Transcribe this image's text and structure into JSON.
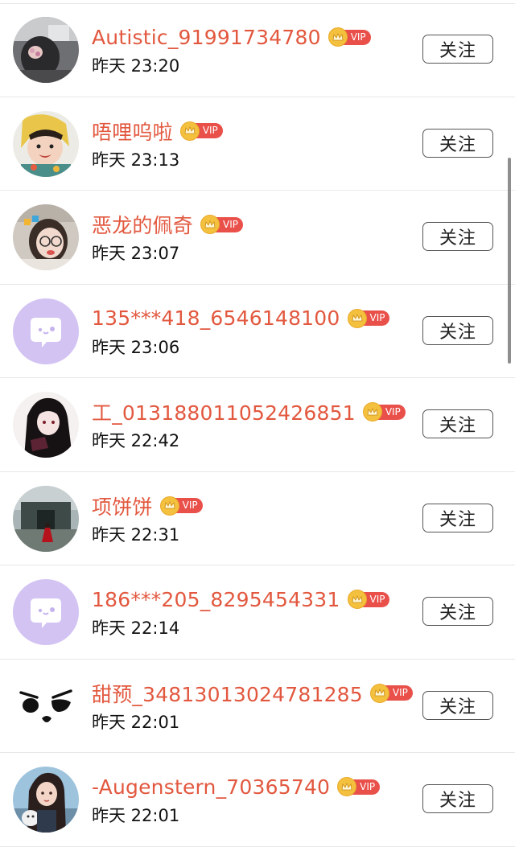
{
  "follow_label": "关注",
  "vip_label": "VIP",
  "colors": {
    "name": "#e2583f",
    "vip_tag": "#e9504a",
    "crown": "#f4c13e"
  },
  "rows": [
    {
      "name": "Autistic_91991734780",
      "time": "昨天 23:20",
      "avatar": "photo-dark"
    },
    {
      "name": "唔哩呜啦",
      "time": "昨天 23:13",
      "avatar": "photo-child"
    },
    {
      "name": "恶龙的佩奇",
      "time": "昨天 23:07",
      "avatar": "photo-girl-glasses"
    },
    {
      "name": "135***418_6546148100",
      "time": "昨天 23:06",
      "avatar": "default-chat-icon"
    },
    {
      "name": "工_013188011052426851",
      "time": "昨天 22:42",
      "avatar": "anime-girl"
    },
    {
      "name": "项饼饼",
      "time": "昨天 22:31",
      "avatar": "photo-landscape"
    },
    {
      "name": "186***205_8295454331",
      "time": "昨天 22:14",
      "avatar": "default-chat-icon"
    },
    {
      "name": "甜预_34813013024781285",
      "time": "昨天 22:01",
      "avatar": "angry-face"
    },
    {
      "name": "-Augenstern_70365740",
      "time": "昨天 22:01",
      "avatar": "illustrated-girl"
    }
  ]
}
